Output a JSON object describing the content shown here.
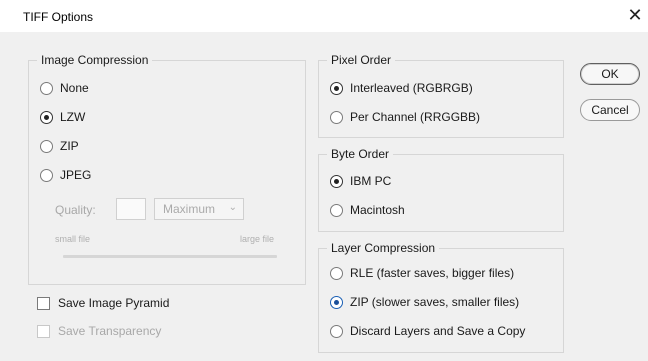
{
  "window": {
    "title": "TIFF Options",
    "close_glyph": "✕"
  },
  "image_compression": {
    "legend": "Image Compression",
    "options": [
      "None",
      "LZW",
      "ZIP",
      "JPEG"
    ],
    "selected": "LZW",
    "quality_label": "Quality:",
    "quality_value": "",
    "quality_select": "Maximum",
    "small_file": "small file",
    "large_file": "large file"
  },
  "pixel_order": {
    "legend": "Pixel Order",
    "options": [
      "Interleaved (RGBRGB)",
      "Per Channel (RRGGBB)"
    ],
    "selected": "Interleaved (RGBRGB)"
  },
  "byte_order": {
    "legend": "Byte Order",
    "options": [
      "IBM PC",
      "Macintosh"
    ],
    "selected": "IBM PC"
  },
  "layer_compression": {
    "legend": "Layer Compression",
    "options": [
      "RLE (faster saves, bigger files)",
      "ZIP (slower saves, smaller files)",
      "Discard Layers and Save a Copy"
    ],
    "selected": "ZIP (slower saves, smaller files)"
  },
  "checkboxes": {
    "save_pyramid": "Save Image Pyramid",
    "save_transparency": "Save Transparency"
  },
  "buttons": {
    "ok": "OK",
    "cancel": "Cancel"
  },
  "colors": {
    "selected_blue": "#1a4f9a",
    "disabled": "#a8a8a8",
    "dialog_bg": "#f0f0f0"
  }
}
